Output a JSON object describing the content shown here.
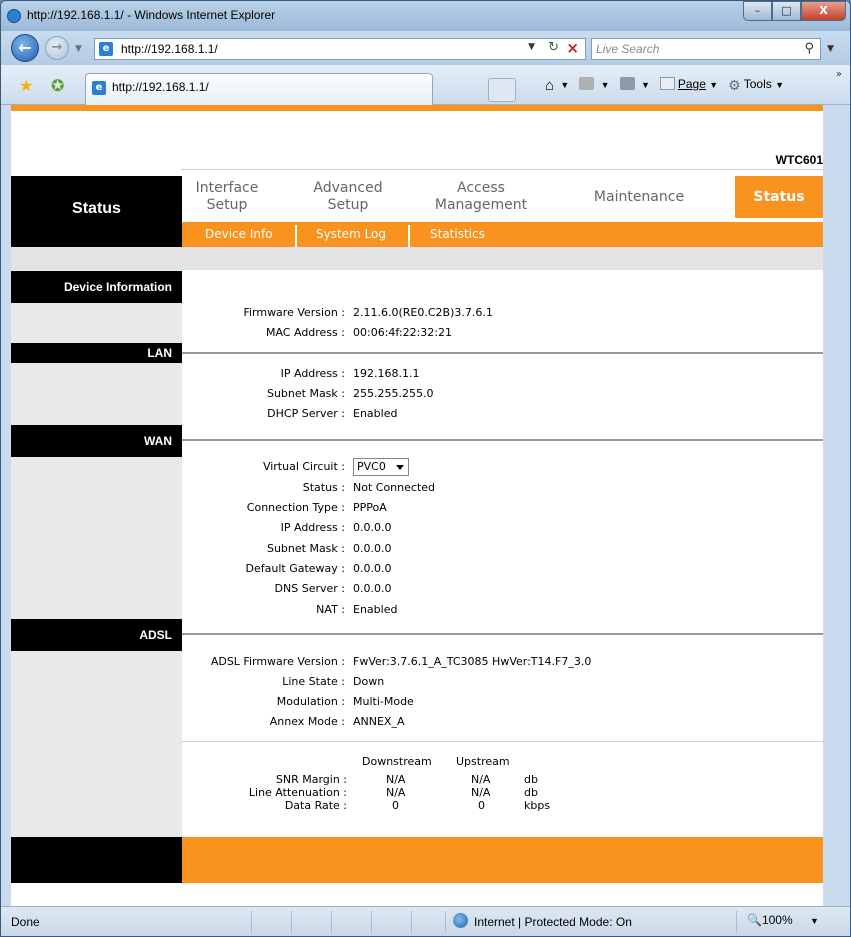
{
  "browser": {
    "window_title": "http://192.168.1.1/ - Windows Internet Explorer",
    "window_buttons": {
      "minimize": "–",
      "maximize": "□",
      "close": "X"
    },
    "address": "http://192.168.1.1/",
    "search_placeholder": "Live Search",
    "tab_title": "http://192.168.1.1/",
    "commands": {
      "page": "Page",
      "tools": "Tools"
    },
    "status": {
      "left": "Done",
      "zone": "Internet | Protected Mode: On",
      "zoom": "100%"
    }
  },
  "router": {
    "model": "WTC601",
    "section_title": "Status",
    "menu": [
      {
        "line1": "Interface",
        "line2": "Setup"
      },
      {
        "line1": "Advanced",
        "line2": "Setup"
      },
      {
        "line1": "Access",
        "line2": "Management"
      },
      {
        "line1": "Maintenance",
        "line2": ""
      },
      {
        "line1": "Status",
        "line2": ""
      }
    ],
    "submenu": [
      "Device Info",
      "System Log",
      "Statistics"
    ],
    "sections": {
      "device_info": "Device Information",
      "lan": "LAN",
      "wan": "WAN",
      "adsl": "ADSL"
    },
    "device": [
      {
        "label": "Firmware Version :",
        "value": "2.11.6.0(RE0.C2B)3.7.6.1"
      },
      {
        "label": "MAC Address :",
        "value": "00:06:4f:22:32:21"
      }
    ],
    "lan": [
      {
        "label": "IP Address :",
        "value": "192.168.1.1"
      },
      {
        "label": "Subnet Mask :",
        "value": "255.255.255.0"
      },
      {
        "label": "DHCP Server :",
        "value": "Enabled"
      }
    ],
    "wan": {
      "virtual_circuit_label": "Virtual Circuit :",
      "virtual_circuit_value": "PVC0",
      "rows": [
        {
          "label": "Status :",
          "value": "Not Connected"
        },
        {
          "label": "Connection Type :",
          "value": "PPPoA"
        },
        {
          "label": "IP Address :",
          "value": "0.0.0.0"
        },
        {
          "label": "Subnet Mask :",
          "value": "0.0.0.0"
        },
        {
          "label": "Default Gateway :",
          "value": "0.0.0.0"
        },
        {
          "label": "DNS Server :",
          "value": "0.0.0.0"
        },
        {
          "label": "NAT :",
          "value": "Enabled"
        }
      ]
    },
    "adsl": [
      {
        "label": "ADSL Firmware Version :",
        "value": "FwVer:3.7.6.1_A_TC3085 HwVer:T14.F7_3.0"
      },
      {
        "label": "Line State :",
        "value": "Down"
      },
      {
        "label": "Modulation :",
        "value": "Multi-Mode"
      },
      {
        "label": "Annex Mode :",
        "value": "ANNEX_A"
      }
    ],
    "stats": {
      "col_downstream": "Downstream",
      "col_upstream": "Upstream",
      "rows": [
        {
          "label": "SNR Margin :",
          "down": "N/A",
          "up": "N/A",
          "unit": "db"
        },
        {
          "label": "Line Attenuation :",
          "down": "N/A",
          "up": "N/A",
          "unit": "db"
        },
        {
          "label": "Data Rate :",
          "down": "0",
          "up": "0",
          "unit": "kbps"
        }
      ]
    }
  }
}
